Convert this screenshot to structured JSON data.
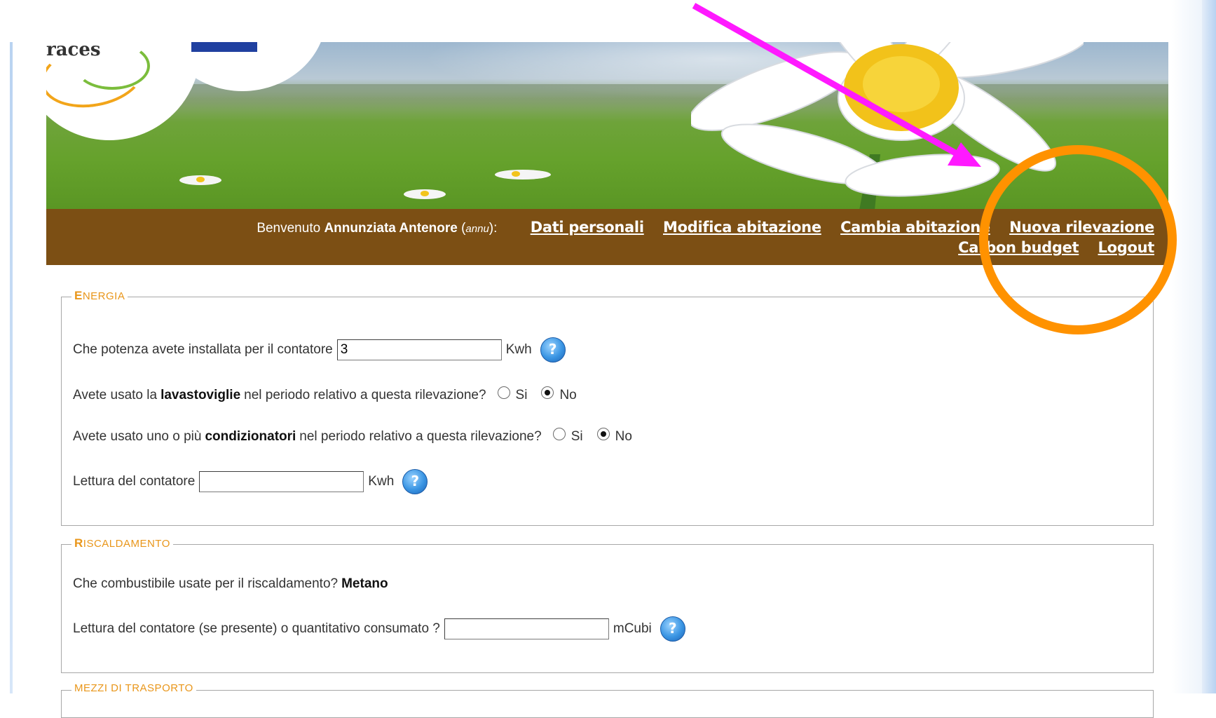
{
  "header": {
    "logo_text": "races"
  },
  "nav": {
    "welcome_prefix": "Benvenuto",
    "user_name": "Annunziata Antenore",
    "user_id_open": "(",
    "user_id": "annu",
    "user_id_close": "):",
    "links": {
      "personal_data": "Dati personali",
      "edit_house": "Modifica abitazione",
      "change_house": "Cambia abitazione",
      "new_reading": "Nuova rilevazione",
      "carbon_budget": "Carbon budget",
      "logout": "Logout"
    }
  },
  "energia": {
    "legend_first": "E",
    "legend_rest": "NERGIA",
    "power_question": "Che potenza avete installata per il contatore",
    "power_value": "3",
    "power_unit": "Kwh",
    "dishwasher_pre": "Avete usato la",
    "dishwasher_bold": "lavastoviglie",
    "dishwasher_post": "nel periodo relativo a questa rilevazione?",
    "dishwasher_selected": "No",
    "ac_pre": "Avete usato uno o più",
    "ac_bold": "condizionatori",
    "ac_post": "nel periodo relativo a questa rilevazione?",
    "ac_selected": "No",
    "option_yes": "Si",
    "option_no": "No",
    "meter_label": "Lettura del contatore",
    "meter_value": "",
    "meter_unit": "Kwh"
  },
  "riscaldamento": {
    "legend_first": "R",
    "legend_rest": "ISCALDAMENTO",
    "fuel_question": "Che combustibile usate per il riscaldamento?",
    "fuel_value": "Metano",
    "meter_label": "Lettura del contatore (se presente) o quantitativo consumato ?",
    "meter_value": "",
    "meter_unit": "mCubi"
  },
  "trasporto": {
    "legend": "MEZZI DI TRASPORTO"
  },
  "annotation": {
    "arrow_color": "#ff19ff",
    "circle_color": "#ff9200"
  },
  "colors": {
    "navbar": "#7c4f14",
    "legend": "#e9961a"
  }
}
